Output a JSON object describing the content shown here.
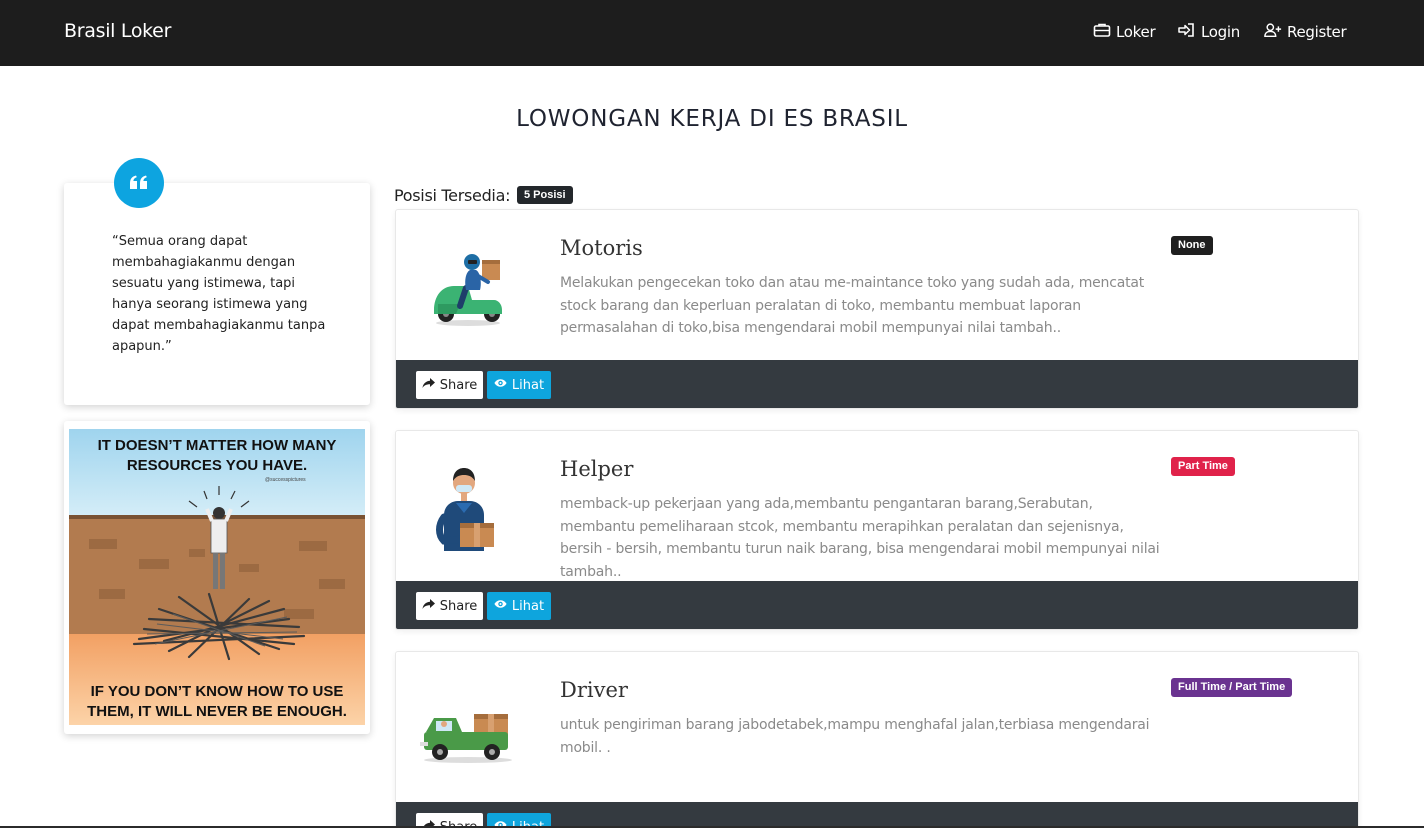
{
  "nav": {
    "brand": "Brasil Loker",
    "links": [
      {
        "label": "Loker",
        "icon": "briefcase-icon"
      },
      {
        "label": "Login",
        "icon": "sign-in-icon"
      },
      {
        "label": "Register",
        "icon": "user-plus-icon"
      }
    ]
  },
  "page": {
    "title": "LOWONGAN KERJA DI ES BRASIL"
  },
  "sidebar": {
    "quote_icon": "quote-icon",
    "quote": "“Semua orang dapat membahagiakanmu dengan sesuatu yang istimewa, tapi hanya seorang istimewa yang dapat membahagiakanmu tanpa apapun.”",
    "poster": {
      "top_text": "IT DOESN’T MATTER HOW MANY RESOURCES YOU HAVE.",
      "handle": "@successpictures",
      "bottom_text": "IF YOU DON’T KNOW HOW TO USE THEM, IT WILL NEVER BE ENOUGH."
    }
  },
  "listing": {
    "available_label": "Posisi Tersedia:",
    "available_count": "5 Posisi",
    "share_label": "Share",
    "view_label": "Lihat",
    "jobs": [
      {
        "title": "Motoris",
        "description": "Melakukan pengecekan toko dan atau me-maintance toko yang sudah ada, mencatat stock barang dan keperluan peralatan di toko, membantu membuat laporan permasalahan di toko,bisa mengendarai mobil mempunyai nilai tambah..",
        "type": "None",
        "type_color": "#1f1f1f",
        "illustration": "scooter-rider"
      },
      {
        "title": "Helper",
        "description": "memback-up pekerjaan yang ada,membantu pengantaran barang,Serabutan, membantu pemeliharaan stcok, membantu merapihkan peralatan dan sejenisnya, bersih - bersih, membantu turun naik barang, bisa mengendarai mobil mempunyai nilai tambah..",
        "type": "Part Time",
        "type_color": "#e0224a",
        "illustration": "courier-with-box"
      },
      {
        "title": "Driver",
        "description": "untuk pengiriman barang jabodetabek,mampu menghafal jalan,terbiasa mengendarai mobil. .",
        "type": "Full Time / Part Time",
        "type_color": "#6a3390",
        "illustration": "delivery-truck"
      }
    ]
  }
}
